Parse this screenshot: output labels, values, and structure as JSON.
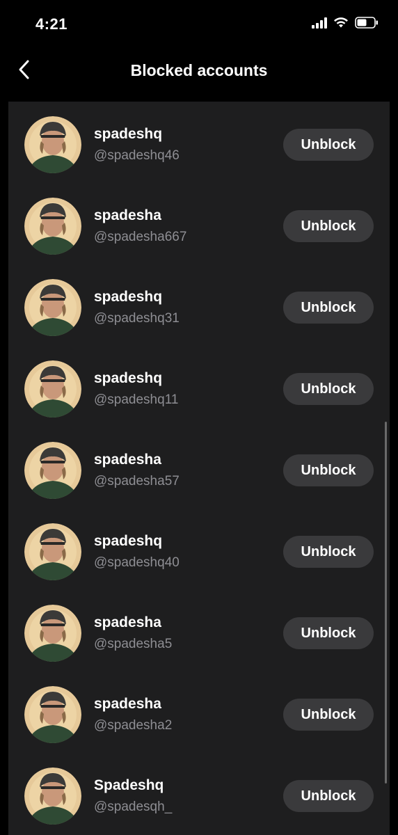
{
  "status_bar": {
    "time": "4:21",
    "icons": [
      "signal-icon",
      "wifi-icon",
      "battery-icon"
    ]
  },
  "header": {
    "title": "Blocked accounts",
    "back_icon": "chevron-left-icon"
  },
  "accounts": [
    {
      "name": "spadeshq",
      "handle": "@spadeshq46",
      "button": "Unblock"
    },
    {
      "name": "spadesha",
      "handle": "@spadesha667",
      "button": "Unblock"
    },
    {
      "name": "spadeshq",
      "handle": "@spadeshq31",
      "button": "Unblock"
    },
    {
      "name": "spadeshq",
      "handle": "@spadeshq11",
      "button": "Unblock"
    },
    {
      "name": "spadesha",
      "handle": "@spadesha57",
      "button": "Unblock"
    },
    {
      "name": "spadeshq",
      "handle": "@spadeshq40",
      "button": "Unblock"
    },
    {
      "name": "spadesha",
      "handle": "@spadesha5",
      "button": "Unblock"
    },
    {
      "name": "spadesha",
      "handle": "@spadesha2",
      "button": "Unblock"
    },
    {
      "name": "Spadeshq",
      "handle": "@spadesqh_",
      "button": "Unblock"
    }
  ],
  "colors": {
    "background": "#000000",
    "list_background": "#1e1e1f",
    "button_background": "#3a3a3c",
    "handle_text": "#8e8e93"
  }
}
